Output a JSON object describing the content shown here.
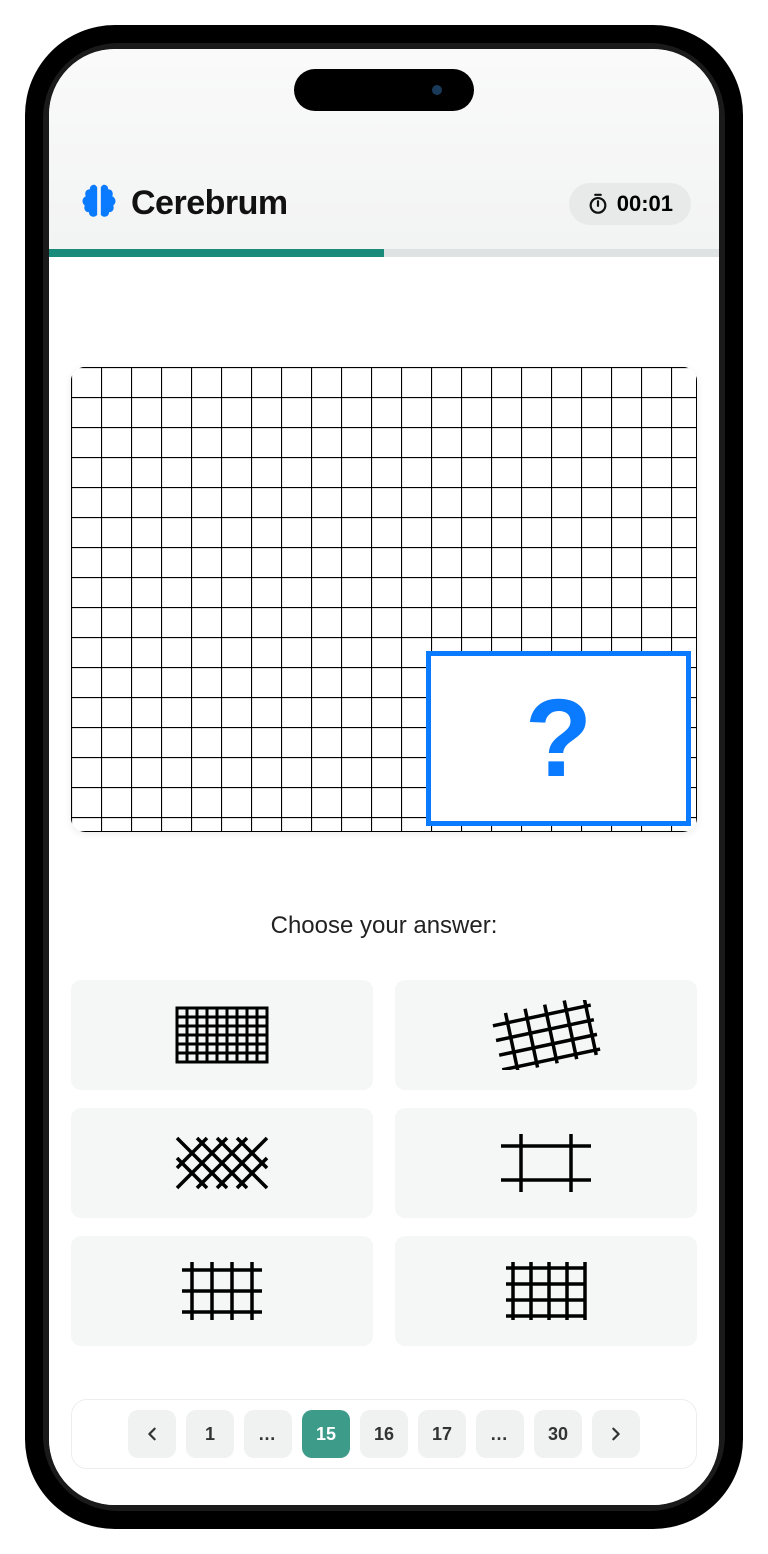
{
  "header": {
    "brand": "Cerebrum",
    "timer": "00:01"
  },
  "progress_percent": 50,
  "puzzle": {
    "missing_mark": "?"
  },
  "prompt_text": "Choose your answer:",
  "answers": [
    {
      "id": "dense-grid"
    },
    {
      "id": "tilted-grid"
    },
    {
      "id": "diamond-lattice"
    },
    {
      "id": "frame-cross"
    },
    {
      "id": "sparse-grid-4x3"
    },
    {
      "id": "sparse-grid-5x4"
    }
  ],
  "pagination": {
    "items": [
      "1",
      "…",
      "15",
      "16",
      "17",
      "…",
      "30"
    ],
    "current": "15"
  }
}
